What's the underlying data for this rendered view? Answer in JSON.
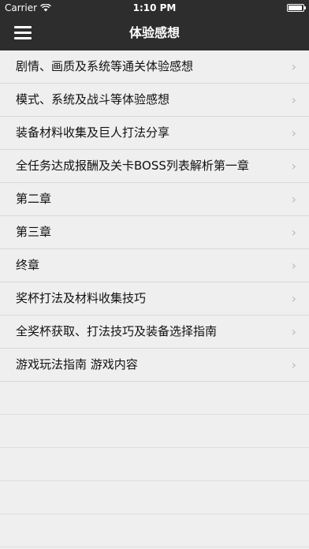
{
  "status": {
    "carrier": "Carrier",
    "time": "1:10 PM"
  },
  "nav": {
    "title": "体验感想"
  },
  "items": [
    {
      "label": "剧情、画质及系统等通关体验感想"
    },
    {
      "label": "模式、系统及战斗等体验感想"
    },
    {
      "label": "装备材料收集及巨人打法分享"
    },
    {
      "label": "全任务达成报酬及关卡BOSS列表解析第一章"
    },
    {
      "label": "第二章"
    },
    {
      "label": "第三章"
    },
    {
      "label": "终章"
    },
    {
      "label": "奖杯打法及材料收集技巧"
    },
    {
      "label": "全奖杯获取、打法技巧及装备选择指南"
    },
    {
      "label": "游戏玩法指南 游戏内容"
    }
  ],
  "chevron": "›",
  "icons": {
    "menu": "menu-icon",
    "wifi": "wifi-icon",
    "battery": "battery-icon"
  }
}
